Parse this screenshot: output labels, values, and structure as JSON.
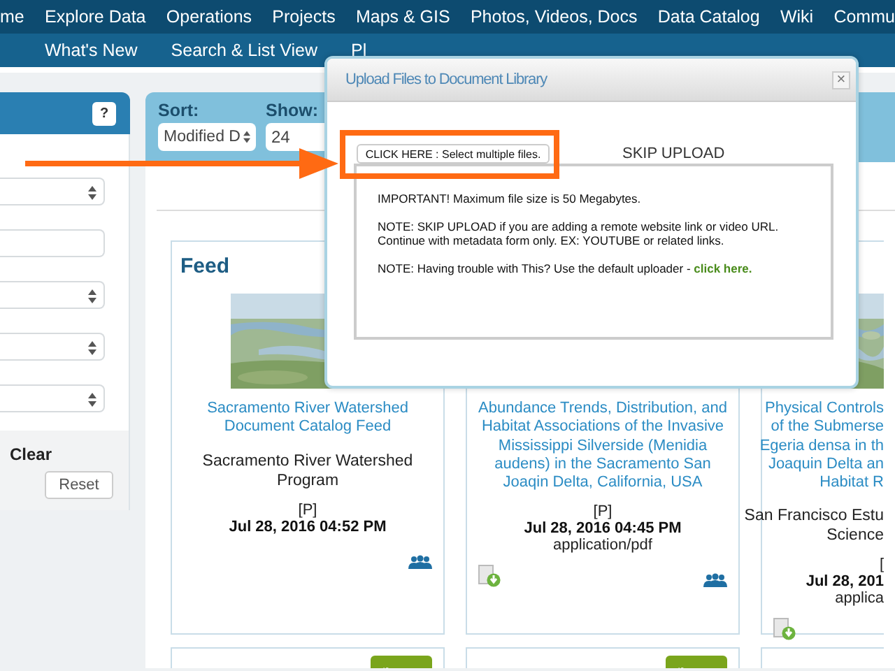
{
  "top_nav": [
    "me",
    "Explore Data",
    "Operations",
    "Projects",
    "Maps & GIS",
    "Photos, Videos, Docs",
    "Data Catalog",
    "Wiki",
    "Commu"
  ],
  "sub_nav": [
    "What's New",
    "Search & List View",
    "Pl"
  ],
  "filter_panel": {
    "help": "?",
    "fields": [
      {
        "kind": "select"
      },
      {
        "kind": "text"
      },
      {
        "kind": "select"
      },
      {
        "kind": "select"
      },
      {
        "kind": "select"
      }
    ],
    "clear": "Clear",
    "reset": "Reset"
  },
  "toolbar": {
    "sort_label": "Sort:",
    "sort_value": "Modified D",
    "show_label": "Show:",
    "show_value": "24"
  },
  "cards": [
    {
      "kind": "full",
      "heading": "Feed",
      "image": {
        "kind": "picture"
      },
      "title": "Sacramento River Watershed Document Catalog Feed",
      "org": "Sacramento River Watershed Program",
      "tag": "[P]",
      "date": "Jul 28, 2016 04:52 PM",
      "download": false,
      "shared": true
    },
    {
      "kind": "full",
      "title": "Abundance Trends, Distribution, and Habitat Associations of the Invasive Mississippi Silverside (Menidia audens) in the Sacramento San Joaqin Delta, California, USA",
      "tag": "[P]",
      "date": "Jul 28, 2016 04:45 PM",
      "mime": "application/pdf",
      "download": true,
      "shared": true
    },
    {
      "kind": "cut",
      "image": {
        "kind": "picture"
      },
      "title_lines": [
        "Physical Controls",
        "of the Submerse",
        "Egeria densa in th",
        "Joaquin Delta an",
        "Habitat R"
      ],
      "org_lines": [
        "San Francisco Estu",
        "Science"
      ],
      "tag": "[",
      "date": "Jul 28, 201",
      "mime": "applica",
      "download": true,
      "shared": false
    }
  ],
  "more_cards": [
    {
      "tools": true
    },
    {
      "tools": true
    },
    {
      "tools": false
    }
  ],
  "dialog": {
    "title": "Upload Files to Document Library",
    "close": "×",
    "select_button": "CLICK HERE : Select multiple files.",
    "skip": "SKIP UPLOAD",
    "notes": [
      "IMPORTANT! Maximum file size is 50 Megabytes.",
      "NOTE: SKIP UPLOAD if you are adding a remote website link or video URL. Continue with metadata form only. EX: YOUTUBE or related links.",
      "NOTE: Having trouble with This? Use the default uploader - **click here.**"
    ]
  }
}
